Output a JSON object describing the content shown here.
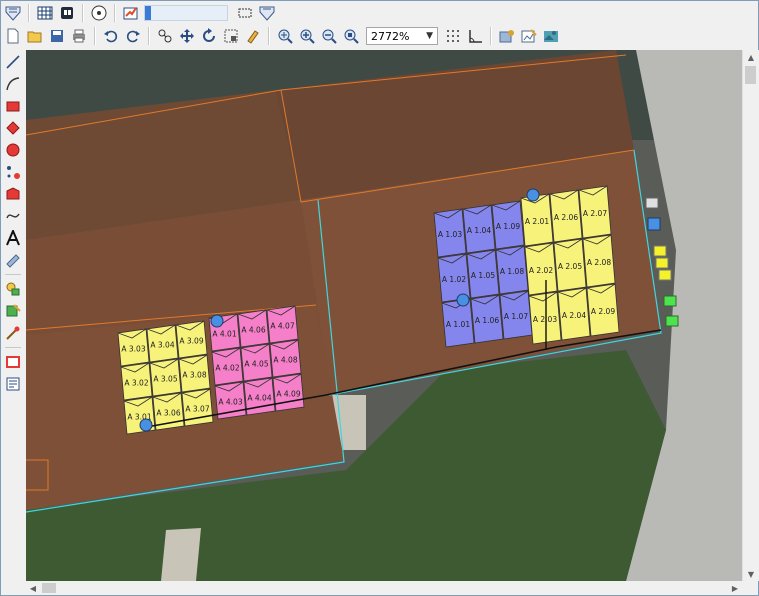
{
  "toolbar": {
    "zoom_value": "2772%"
  },
  "canvas": {
    "panels": [
      {
        "label": "A 3.03",
        "color": "#f7f27a",
        "group": "A3"
      },
      {
        "label": "A 3.04",
        "color": "#f7f27a",
        "group": "A3"
      },
      {
        "label": "A 3.09",
        "color": "#f7f27a",
        "group": "A3"
      },
      {
        "label": "A 3.02",
        "color": "#f7f27a",
        "group": "A3"
      },
      {
        "label": "A 3.05",
        "color": "#f7f27a",
        "group": "A3"
      },
      {
        "label": "A 3.08",
        "color": "#f7f27a",
        "group": "A3"
      },
      {
        "label": "A 3.01",
        "color": "#f7f27a",
        "group": "A3"
      },
      {
        "label": "A 3.06",
        "color": "#f7f27a",
        "group": "A3"
      },
      {
        "label": "A 3.07",
        "color": "#f7f27a",
        "group": "A3"
      },
      {
        "label": "A 4.01",
        "color": "#f57fc8",
        "group": "A4"
      },
      {
        "label": "A 4.06",
        "color": "#f57fc8",
        "group": "A4"
      },
      {
        "label": "A 4.07",
        "color": "#f57fc8",
        "group": "A4"
      },
      {
        "label": "A 4.02",
        "color": "#f57fc8",
        "group": "A4"
      },
      {
        "label": "A 4.05",
        "color": "#f57fc8",
        "group": "A4"
      },
      {
        "label": "A 4.08",
        "color": "#f57fc8",
        "group": "A4"
      },
      {
        "label": "A 4.03",
        "color": "#f57fc8",
        "group": "A4"
      },
      {
        "label": "A 4.04",
        "color": "#f57fc8",
        "group": "A4"
      },
      {
        "label": "A 4.09",
        "color": "#f57fc8",
        "group": "A4"
      },
      {
        "label": "A 1.03",
        "color": "#8585ee",
        "group": "A1"
      },
      {
        "label": "A 1.04",
        "color": "#8585ee",
        "group": "A1"
      },
      {
        "label": "A 1.09",
        "color": "#8585ee",
        "group": "A1"
      },
      {
        "label": "A 1.02",
        "color": "#8585ee",
        "group": "A1"
      },
      {
        "label": "A 1.05",
        "color": "#8585ee",
        "group": "A1"
      },
      {
        "label": "A 1.08",
        "color": "#8585ee",
        "group": "A1"
      },
      {
        "label": "A 1.01",
        "color": "#8585ee",
        "group": "A1"
      },
      {
        "label": "A 1.06",
        "color": "#8585ee",
        "group": "A1"
      },
      {
        "label": "A 1.07",
        "color": "#8585ee",
        "group": "A1"
      },
      {
        "label": "A 2.01",
        "color": "#f7f27a",
        "group": "A2"
      },
      {
        "label": "A 2.06",
        "color": "#f7f27a",
        "group": "A2"
      },
      {
        "label": "A 2.07",
        "color": "#f7f27a",
        "group": "A2"
      },
      {
        "label": "A 2.02",
        "color": "#f7f27a",
        "group": "A2"
      },
      {
        "label": "A 2.05",
        "color": "#f7f27a",
        "group": "A2"
      },
      {
        "label": "A 2.08",
        "color": "#f7f27a",
        "group": "A2"
      },
      {
        "label": "A 2.03",
        "color": "#f7f27a",
        "group": "A2"
      },
      {
        "label": "A 2.04",
        "color": "#f7f27a",
        "group": "A2"
      },
      {
        "label": "A 2.09",
        "color": "#f7f27a",
        "group": "A2"
      }
    ],
    "colors": {
      "roof": "#7a4e36",
      "outline_cyan": "#3fd6e0",
      "outline_orange": "#e07a2a",
      "inverter_blue": "#4a90e2",
      "yellow_box": "#f5f22a",
      "green_box": "#4ee34e"
    }
  }
}
